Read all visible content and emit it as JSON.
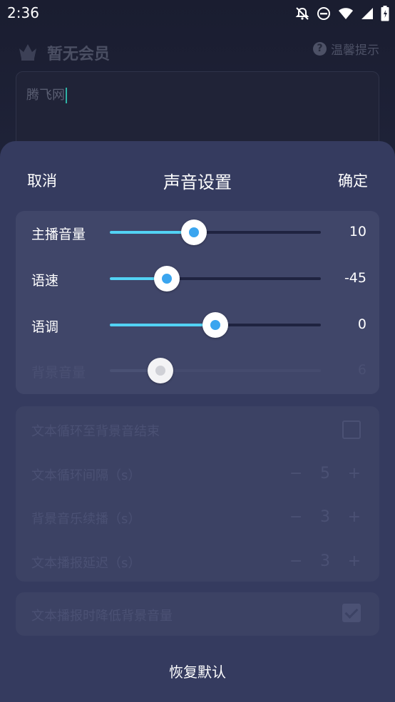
{
  "status_bar": {
    "time": "2:36",
    "icons": [
      "bell-off-icon",
      "do-not-disturb-icon",
      "wifi-icon",
      "signal-icon",
      "battery-icon"
    ]
  },
  "app": {
    "member_title": "暂无会员",
    "tips_label": "温馨提示",
    "text_value": "腾飞网"
  },
  "sheet": {
    "title": "声音设置",
    "cancel": "取消",
    "confirm": "确定",
    "sliders": [
      {
        "label": "主播音量",
        "value": "10",
        "fraction": 0.4,
        "enabled": true
      },
      {
        "label": "语速",
        "value": "-45",
        "fraction": 0.27,
        "enabled": true
      },
      {
        "label": "语调",
        "value": "0",
        "fraction": 0.5,
        "enabled": true
      },
      {
        "label": "背景音量",
        "value": "6",
        "fraction": 0.24,
        "enabled": false
      }
    ],
    "options": {
      "loop_to_end_label": "文本循环至背景音结束",
      "loop_interval_label": "文本循环间隔（s）",
      "loop_interval_value": "5",
      "bg_continue_label": "背景音乐续播（s）",
      "bg_continue_value": "3",
      "delay_label": "文本播报延迟（s）",
      "delay_value": "3",
      "lower_bg_label": "文本播报时降低背景音量",
      "minus": "−",
      "plus": "+"
    },
    "restore_default": "恢复默认"
  },
  "colors": {
    "accent": "#52d2f4",
    "thumb_dot": "#3aa5ef",
    "sheet_bg": "#353b5f",
    "card_bg": "#404669"
  }
}
